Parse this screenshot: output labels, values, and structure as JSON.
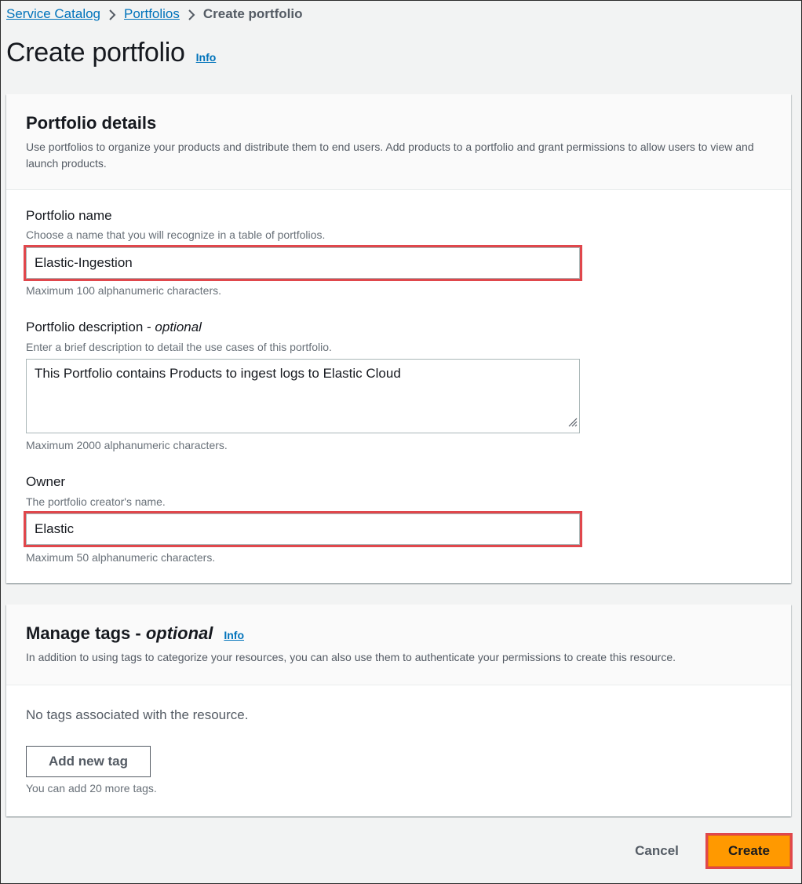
{
  "breadcrumb": {
    "items": [
      "Service Catalog",
      "Portfolios"
    ],
    "current": "Create portfolio"
  },
  "page": {
    "title": "Create portfolio",
    "info_label": "Info"
  },
  "portfolio_details": {
    "title": "Portfolio details",
    "description": "Use portfolios to organize your products and distribute them to end users. Add products to a portfolio and grant permissions to allow users to view and launch products.",
    "name": {
      "label": "Portfolio name",
      "description": "Choose a name that you will recognize in a table of portfolios.",
      "value": "Elastic-Ingestion",
      "hint": "Maximum 100 alphanumeric characters."
    },
    "portfolio_description": {
      "label": "Portfolio description - ",
      "label_optional": "optional",
      "description": "Enter a brief description to detail the use cases of this portfolio.",
      "value": "This Portfolio contains Products to ingest logs to Elastic Cloud",
      "hint": "Maximum 2000 alphanumeric characters."
    },
    "owner": {
      "label": "Owner",
      "description": "The portfolio creator's name.",
      "value": "Elastic",
      "hint": "Maximum 50 alphanumeric characters."
    }
  },
  "manage_tags": {
    "title": "Manage tags - ",
    "title_optional": "optional",
    "info_label": "Info",
    "description": "In addition to using tags to categorize your resources, you can also use them to authenticate your permissions to create this resource.",
    "empty_text": "No tags associated with the resource.",
    "add_button": "Add new tag",
    "hint": "You can add 20 more tags."
  },
  "actions": {
    "cancel": "Cancel",
    "create": "Create"
  },
  "colors": {
    "link": "#0073bb",
    "primary": "#ff9900",
    "highlight": "#e0474c"
  }
}
